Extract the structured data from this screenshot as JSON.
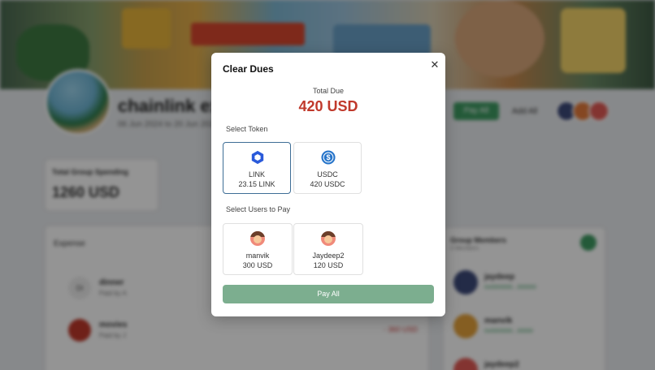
{
  "background": {
    "project_title": "chainlink exp",
    "project_dates": "06 Jun 2024 to 20 Jun 2024",
    "header_button_label": "Pay All",
    "add_all_label": "Add All",
    "spending": {
      "label": "Total Group Spending",
      "value": "1260 USD"
    },
    "expenses": {
      "title": "Expense",
      "rows": [
        {
          "icon_text": "Dl",
          "name": "dinner",
          "paid_by": "Paid by A",
          "amount": ""
        },
        {
          "icon_text": "",
          "name": "movies",
          "paid_by": "Paid by J",
          "amount": "- 360 USD"
        }
      ]
    },
    "members": {
      "title": "Group Members",
      "subtitle": "3 Members",
      "list": [
        {
          "name": "jaydeep",
          "address": "0x0000000...000000"
        },
        {
          "name": "manvik",
          "address": "0x0000000...00000"
        },
        {
          "name": "jaydeep2",
          "address": ""
        }
      ]
    }
  },
  "modal": {
    "title": "Clear Dues",
    "close_icon": "close-icon",
    "total_label": "Total Due",
    "total_value": "420 USD",
    "select_token_label": "Select Token",
    "tokens": [
      {
        "icon": "chainlink-hexagon-icon",
        "name": "LINK",
        "amount": "23.15 LINK",
        "selected": true
      },
      {
        "icon": "usdc-dollar-icon",
        "name": "USDC",
        "amount": "420 USDC",
        "selected": false
      }
    ],
    "select_users_label": "Select Users to Pay",
    "users": [
      {
        "icon": "user-avatar-icon",
        "name": "manvik",
        "amount": "300 USD"
      },
      {
        "icon": "user-avatar-icon",
        "name": "Jaydeep2",
        "amount": "120 USD"
      }
    ],
    "pay_button_label": "Pay All"
  },
  "colors": {
    "total_due": "#c0392b",
    "selected_border": "#3e6e96",
    "pay_button": "#7cae8f",
    "link_icon": "#2a5ada",
    "usdc_icon": "#2775ca"
  }
}
